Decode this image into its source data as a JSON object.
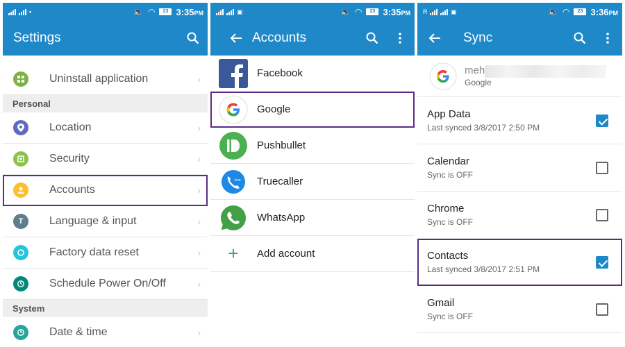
{
  "status": {
    "left": {
      "time": "3:35",
      "ampm": "PM",
      "battery": "23"
    },
    "mid": {
      "time": "3:35",
      "ampm": "PM",
      "battery": "23"
    },
    "right": {
      "time": "3:36",
      "ampm": "PM",
      "battery": "23",
      "roaming": "R"
    }
  },
  "settings": {
    "title": "Settings",
    "items": [
      {
        "label": "Uninstall application",
        "icon": "uninstall-icon",
        "color": "#7cb342"
      },
      {
        "section": "Personal"
      },
      {
        "label": "Location",
        "icon": "location-icon",
        "color": "#5c6bc0"
      },
      {
        "label": "Security",
        "icon": "security-icon",
        "color": "#8bc34a"
      },
      {
        "label": "Accounts",
        "icon": "accounts-icon",
        "color": "#fbc02d"
      },
      {
        "label": "Language & input",
        "icon": "language-icon",
        "color": "#607d8b"
      },
      {
        "label": "Factory data reset",
        "icon": "reset-icon",
        "color": "#26c6da"
      },
      {
        "label": "Schedule Power On/Off",
        "icon": "schedule-icon",
        "color": "#00897b"
      },
      {
        "section": "System"
      },
      {
        "label": "Date & time",
        "icon": "clock-icon",
        "color": "#26a69a"
      }
    ]
  },
  "accounts": {
    "title": "Accounts",
    "items": [
      {
        "label": "Facebook",
        "icon": "facebook-icon",
        "color": "#3b5998"
      },
      {
        "label": "Google",
        "icon": "google-icon",
        "color": "#4285f4"
      },
      {
        "label": "Pushbullet",
        "icon": "pushbullet-icon",
        "color": "#4caf50"
      },
      {
        "label": "Truecaller",
        "icon": "truecaller-icon",
        "color": "#1e88e5"
      },
      {
        "label": "WhatsApp",
        "icon": "whatsapp-icon",
        "color": "#43a047"
      },
      {
        "label": "Add account",
        "icon": "plus-icon",
        "color": "#26a69a"
      }
    ]
  },
  "sync": {
    "title": "Sync",
    "account_name": "meh",
    "account_type": "Google",
    "items": [
      {
        "title": "App Data",
        "sub": "Last synced 3/8/2017 2:50 PM",
        "checked": true
      },
      {
        "title": "Calendar",
        "sub": "Sync is OFF",
        "checked": false
      },
      {
        "title": "Chrome",
        "sub": "Sync is OFF",
        "checked": false
      },
      {
        "title": "Contacts",
        "sub": "Last synced 3/8/2017 2:51 PM",
        "checked": true
      },
      {
        "title": "Gmail",
        "sub": "Sync is OFF",
        "checked": false
      }
    ]
  },
  "colors": {
    "appbar": "#1e88c8",
    "highlight": "#5c2a86",
    "check": "#1e88c8"
  }
}
